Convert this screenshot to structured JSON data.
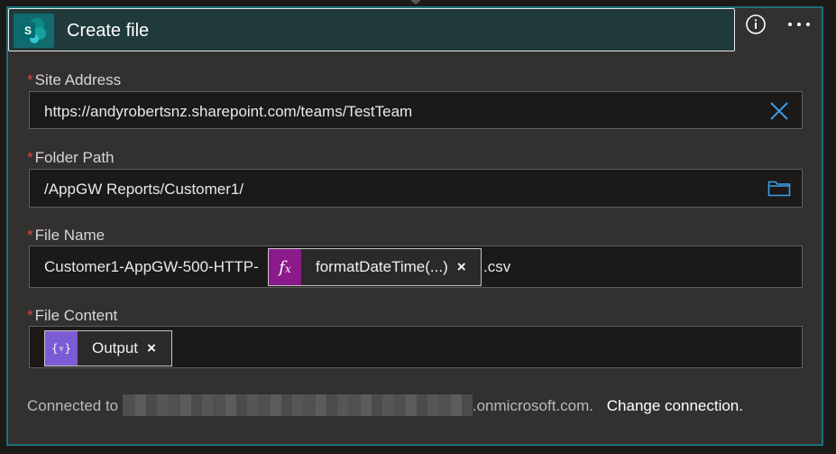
{
  "header": {
    "title": "Create file",
    "icon": "sharepoint-icon",
    "brand_color": "#106b6e"
  },
  "fields": {
    "site_address": {
      "label": "Site Address",
      "required_mark": "*",
      "value": "https://andyrobertsnz.sharepoint.com/teams/TestTeam"
    },
    "folder_path": {
      "label": "Folder Path",
      "required_mark": "*",
      "value": "/AppGW Reports/Customer1/"
    },
    "file_name": {
      "label": "File Name",
      "required_mark": "*",
      "prefix": "Customer1-AppGW-500-HTTP-",
      "token": {
        "label": "formatDateTime(...)",
        "icon": "function-icon",
        "color": "#8b1a8b"
      },
      "suffix": ".csv"
    },
    "file_content": {
      "label": "File Content",
      "required_mark": "*",
      "token": {
        "label": "Output",
        "icon": "variable-icon",
        "color": "#7c5bd6"
      }
    }
  },
  "footer": {
    "connected_prefix": "Connected to",
    "connected_suffix": ".onmicrosoft.com.",
    "change_link": "Change connection."
  }
}
